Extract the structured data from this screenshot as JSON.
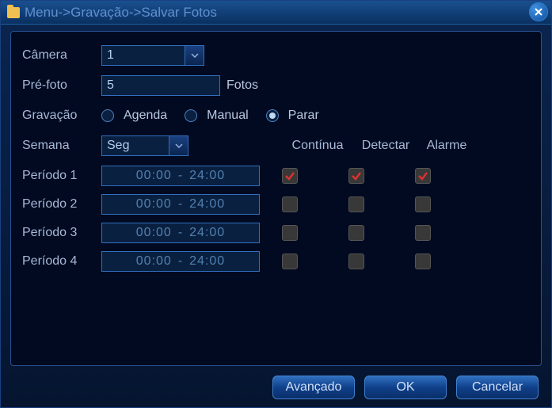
{
  "titlebar": {
    "breadcrumb": "Menu->Gravação->Salvar Fotos"
  },
  "labels": {
    "camera": "Câmera",
    "prephoto": "Pré-foto",
    "photos_suffix": "Fotos",
    "recording": "Gravação",
    "week": "Semana",
    "period1": "Período 1",
    "period2": "Período 2",
    "period3": "Período 3",
    "period4": "Período 4"
  },
  "fields": {
    "camera_value": "1",
    "prephoto_value": "5",
    "week_value": "Seg"
  },
  "radios": {
    "schedule": "Agenda",
    "manual": "Manual",
    "stop": "Parar"
  },
  "columns": {
    "continuous": "Contínua",
    "detect": "Detectar",
    "alarm": "Alarme"
  },
  "periods": {
    "p1": {
      "start": "00:00",
      "sep": "-",
      "end": "24:00"
    },
    "p2": {
      "start": "00:00",
      "sep": "-",
      "end": "24:00"
    },
    "p3": {
      "start": "00:00",
      "sep": "-",
      "end": "24:00"
    },
    "p4": {
      "start": "00:00",
      "sep": "-",
      "end": "24:00"
    }
  },
  "buttons": {
    "advanced": "Avançado",
    "ok": "OK",
    "cancel": "Cancelar"
  }
}
